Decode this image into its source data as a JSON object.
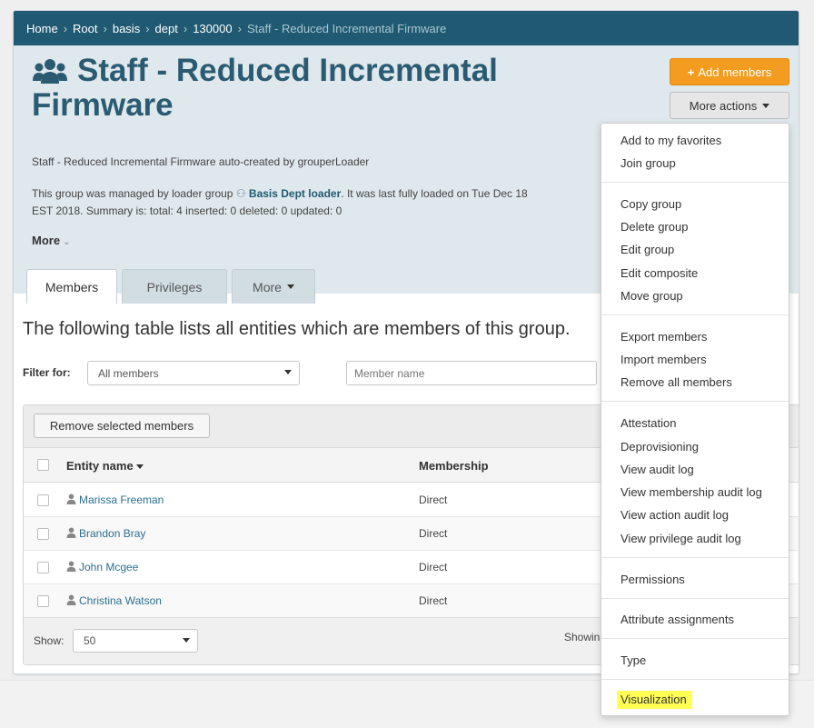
{
  "breadcrumb": {
    "items": [
      "Home",
      "Root",
      "basis",
      "dept",
      "130000"
    ],
    "current": "Staff - Reduced Incremental Firmware"
  },
  "header": {
    "title": "Staff - Reduced Incremental Firmware",
    "add_members": "Add members",
    "more_actions": "More actions",
    "description": "Staff - Reduced Incremental Firmware auto-created by grouperLoader",
    "loader_text_pre": "This group was managed by loader group ",
    "loader_group": "Basis Dept loader",
    "loader_text_post": ". It was last fully loaded on Tue Dec 18",
    "loader_line2": "EST 2018. Summary is: total: 4 inserted: 0 deleted: 0 updated: 0",
    "more": "More"
  },
  "tabs": [
    {
      "label": "Members"
    },
    {
      "label": "Privileges"
    },
    {
      "label": "More"
    }
  ],
  "main": {
    "lead": "The following table lists all entities which are members of this group.",
    "filter_label": "Filter for:",
    "filter_value": "All members",
    "member_placeholder": "Member name",
    "remove_selected": "Remove selected members",
    "col_entity": "Entity name",
    "col_membership": "Membership",
    "rows": [
      {
        "name": "Marissa Freeman",
        "membership": "Direct"
      },
      {
        "name": "Brandon Bray",
        "membership": "Direct"
      },
      {
        "name": "John Mcgee",
        "membership": "Direct"
      },
      {
        "name": "Christina Watson",
        "membership": "Direct"
      }
    ],
    "show_label": "Show:",
    "show_value": "50",
    "showing": "Showin"
  },
  "menu": {
    "items": [
      "Add to my favorites",
      "Join group",
      "Copy group",
      "Delete group",
      "Edit group",
      "Edit composite",
      "Move group",
      "Export members",
      "Import members",
      "Remove all members",
      "Attestation",
      "Deprovisioning",
      "View audit log",
      "View membership audit log",
      "View action audit log",
      "View privilege audit log",
      "Permissions",
      "Attribute assignments",
      "Type",
      "Visualization"
    ]
  },
  "colors": {
    "brand": "#1f5a72",
    "accent": "#f39c20",
    "highlight": "#ffff55"
  }
}
